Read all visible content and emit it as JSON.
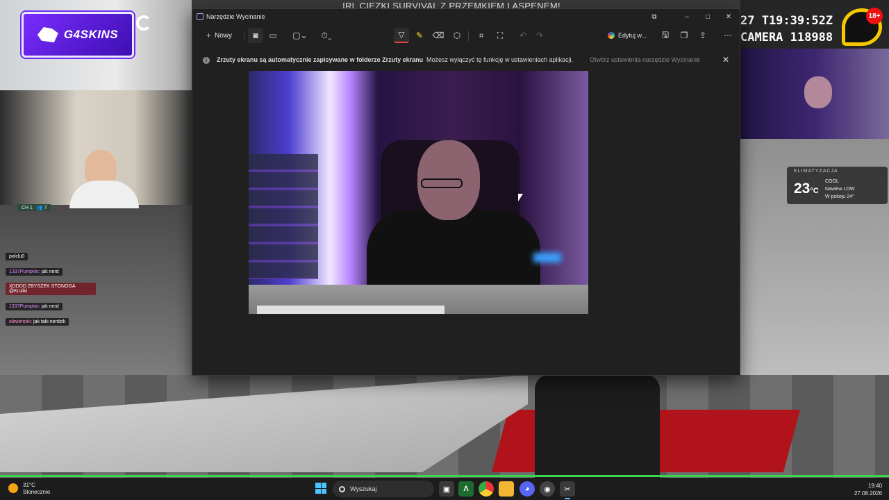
{
  "stream": {
    "title": "IRL CIEZKI SURVIVAL Z PRZEMKIEM I ASPENEM!",
    "logo_text": "G4SKINS",
    "timestamp_line1": "27 T19:39:52Z",
    "timestamp_line2": "CAMERA 118988",
    "age_rating": "18+",
    "ac": {
      "title": "KLIMATYZACJA",
      "temp": "23",
      "unit": "°C",
      "mode": "COOL",
      "fan": "Nawiew LOW",
      "room": "W pokoju 24°"
    },
    "chat": {
      "header": "CH 1",
      "users_count": "7",
      "messages": [
        {
          "user": "polclu0",
          "text": ""
        },
        {
          "user": "1337Pumpkin:",
          "text": "jak nerd"
        },
        {
          "user": "",
          "text": "XDDDD ZBYSZEK STONOGA @Kruliki"
        },
        {
          "user": "1337Pumpkin:",
          "text": "jak nerd"
        },
        {
          "user": "oliwiereek:",
          "text": "jak taki nerdzik"
        }
      ]
    }
  },
  "window": {
    "title": "Narzędzie Wycinanie",
    "controls": {
      "min": "–",
      "max": "□",
      "close": "✕"
    }
  },
  "toolbar": {
    "new_label": "Nowy",
    "edit_label": "Edytuj w..."
  },
  "infobar": {
    "bold_text": "Zrzuty ekranu są automatycznie zapisywane w folderze Zrzuty ekranu",
    "text": "Możesz wyłączyć tę funkcję w ustawieniach aplikacji.",
    "link": "Otwórz ustawienia narzędzie Wycinanie",
    "close": "✕"
  },
  "taskbar": {
    "weather_temp": "31°C",
    "weather_desc": "Słonecznie",
    "search_placeholder": "Wyszukaj",
    "time": "19:40",
    "date": "27.08.2026"
  },
  "colors": {
    "accent": "#4cc2ff",
    "hud_green": "#38d84a",
    "logo_purple": "#7a2cff"
  }
}
